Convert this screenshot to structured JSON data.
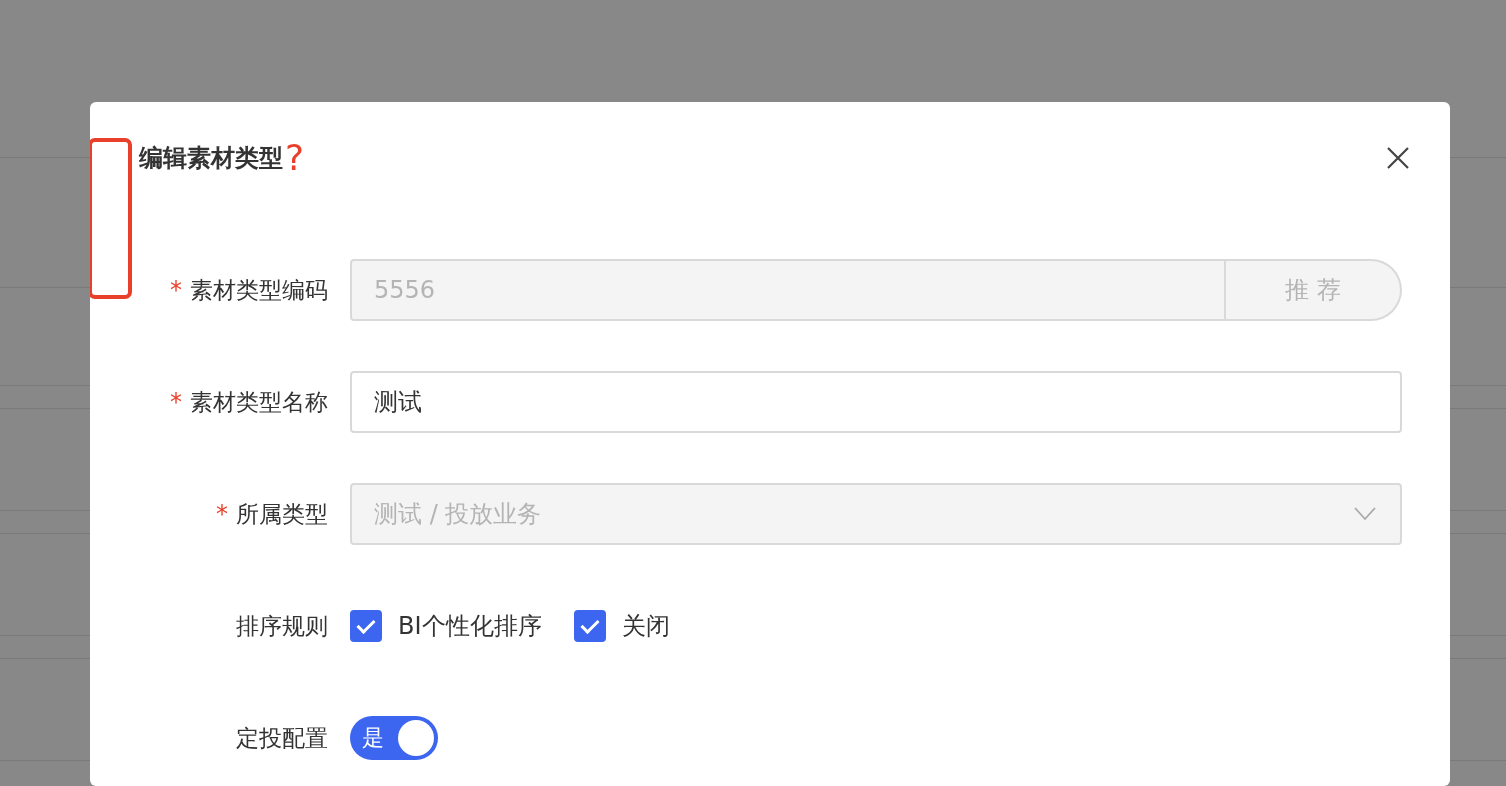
{
  "dialog": {
    "title": "编辑素材类型",
    "annotation_mark": "?",
    "fields": [
      {
        "kind": "text_with_button",
        "label": "素材类型编码",
        "required_mark": "*",
        "value": "5556",
        "disabled": true,
        "button": "推 荐"
      },
      {
        "kind": "text",
        "label": "素材类型名称",
        "required_mark": "*",
        "value": "测试",
        "disabled": false
      },
      {
        "kind": "select",
        "label": "所属类型",
        "required_mark": "*",
        "value": "测试 / 投放业务",
        "disabled": true
      },
      {
        "kind": "checkboxes",
        "label": "排序规则",
        "options": [
          {
            "label": "BI个性化排序",
            "checked": true
          },
          {
            "label": "关闭",
            "checked": true
          }
        ]
      },
      {
        "kind": "switch",
        "label": "定投配置",
        "on": true,
        "text": "是"
      }
    ]
  }
}
